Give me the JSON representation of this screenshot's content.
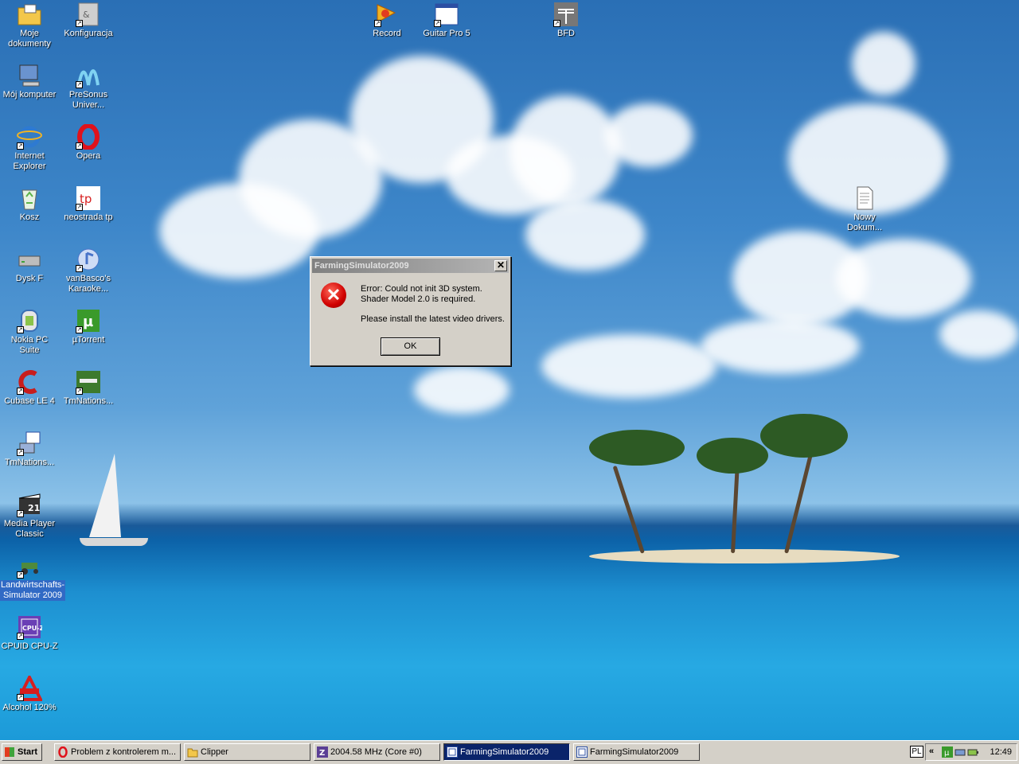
{
  "desktop": {
    "icons": [
      {
        "label": "Moje dokumenty",
        "icon": "folder-documents-icon",
        "color": "#f3c74a",
        "selected": false
      },
      {
        "label": "Konfiguracja",
        "icon": "config-icon",
        "color": "#c9c9c9",
        "selected": false
      },
      {
        "label": "Record",
        "icon": "record-icon",
        "color": "#e8a51a",
        "selected": false
      },
      {
        "label": "Guitar Pro 5",
        "icon": "window-icon",
        "color": "#2c4fa3",
        "selected": false
      },
      {
        "label": "BFD",
        "icon": "bfd-icon",
        "color": "#777777",
        "selected": false
      },
      {
        "label": "Mój komputer",
        "icon": "computer-icon",
        "color": "#6a93cf",
        "selected": false
      },
      {
        "label": "PreSonus Univer...",
        "icon": "presonus-icon",
        "color": "#7fd2f2",
        "selected": false
      },
      {
        "label": "Internet Explorer",
        "icon": "ie-icon",
        "color": "#2e7ad1",
        "selected": false
      },
      {
        "label": "Opera",
        "icon": "opera-icon",
        "color": "#e0121b",
        "selected": false
      },
      {
        "label": "Kosz",
        "icon": "recycle-bin-icon",
        "color": "#5db44a",
        "selected": false
      },
      {
        "label": "neostrada tp",
        "icon": "tp-icon",
        "color": "#d62020",
        "selected": false
      },
      {
        "label": "Dysk F",
        "icon": "drive-icon",
        "color": "#bdbdbd",
        "selected": false
      },
      {
        "label": "vanBasco's Karaoke...",
        "icon": "karaoke-icon",
        "color": "#4a74c9",
        "selected": false
      },
      {
        "label": "Nokia PC Suite",
        "icon": "nokia-icon",
        "color": "#3b6fb5",
        "selected": false
      },
      {
        "label": "µTorrent",
        "icon": "utorrent-icon",
        "color": "#3a9a2b",
        "selected": false
      },
      {
        "label": "Cubase LE 4",
        "icon": "cubase-icon",
        "color": "#c81d1d",
        "selected": false
      },
      {
        "label": "TmNations...",
        "icon": "tmnations-icon",
        "color": "#3d7a2d",
        "selected": false
      },
      {
        "label": "TmNations...",
        "icon": "setup-icon",
        "color": "#7a9ad0",
        "selected": false
      },
      {
        "label": "Media Player Classic",
        "icon": "media-player-icon",
        "color": "#333333",
        "selected": false
      },
      {
        "label": "Landwirtschafts-Simulator 2009",
        "icon": "tractor-icon",
        "color": "#4f8a3d",
        "selected": true
      },
      {
        "label": "CPUID CPU-Z",
        "icon": "cpuz-icon",
        "color": "#6a3fb5",
        "selected": false
      },
      {
        "label": "Alcohol 120%",
        "icon": "alcohol-icon",
        "color": "#d61f1f",
        "selected": false
      },
      {
        "label": "Nowy Dokum...",
        "icon": "text-document-icon",
        "color": "#ffffff",
        "selected": false
      }
    ]
  },
  "dialog": {
    "title": "FarmingSimulator2009",
    "close_label": "✕",
    "line1": "Error: Could not init 3D system.",
    "line2": "Shader Model 2.0 is required.",
    "line3": "Please install the latest video drivers.",
    "ok_label": "OK"
  },
  "taskbar": {
    "start_label": "Start",
    "buttons": [
      {
        "label": "Problem z kontrolerem m...",
        "icon": "opera-icon",
        "active": false
      },
      {
        "label": "Clipper",
        "icon": "folder-icon",
        "active": false
      },
      {
        "label": "2004.58 MHz (Core #0)",
        "icon": "cpu-freq-icon",
        "active": false
      },
      {
        "label": "FarmingSimulator2009",
        "icon": "app-window-icon",
        "active": true
      },
      {
        "label": "FarmingSimulator2009",
        "icon": "app-window-icon",
        "active": false
      }
    ],
    "language": "PL",
    "chevron": "«",
    "clock": "12:49"
  }
}
